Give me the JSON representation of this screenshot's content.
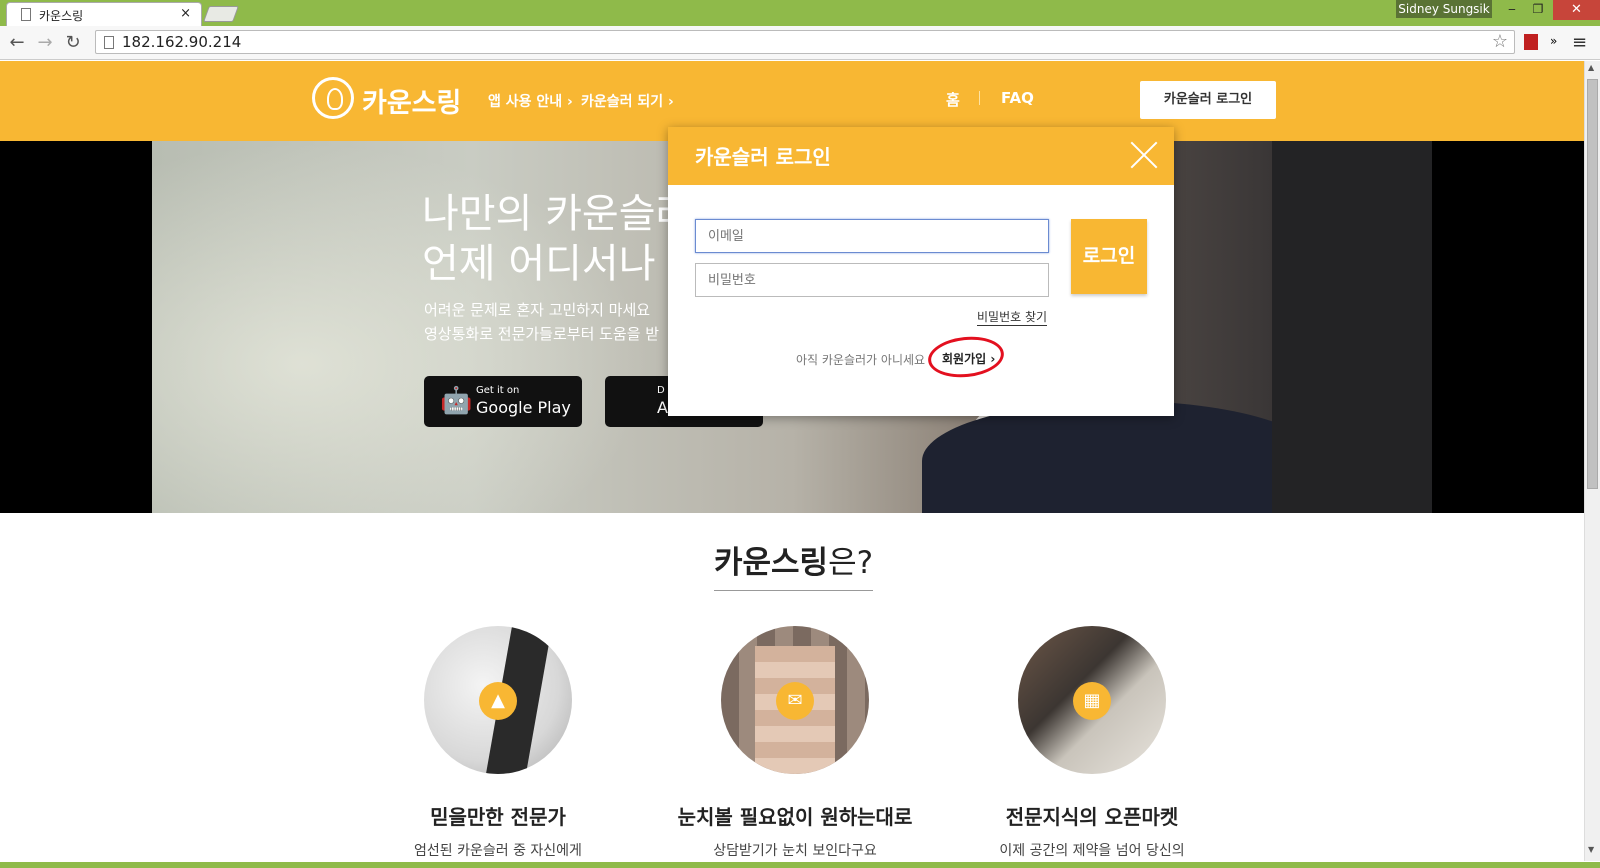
{
  "browser": {
    "tab_title": "카운스링",
    "tab_close": "×",
    "profile_name": "Sidney Sungsik",
    "url": "182.162.90.214",
    "minimize": "‒",
    "restore": "❐",
    "close": "✕",
    "back": "←",
    "forward": "→",
    "reload": "↻",
    "star": "☆",
    "more_extensions": "»",
    "menu": "≡"
  },
  "header": {
    "logo_text": "카운스링",
    "nav": [
      {
        "label": "앱 사용 안내 ›"
      },
      {
        "label": "카운슬러 되기 ›"
      }
    ],
    "home": "홈",
    "faq": "FAQ",
    "counselor_login": "카운슬러 로그인"
  },
  "hero": {
    "title_line1": "나만의 카운슬러",
    "title_line2": "언제 어디서나",
    "sub_line1": "어려운 문제로 혼자 고민하지 마세요",
    "sub_line2": "영상통화로 전문가들로부터 도움을 받",
    "google_small": "Get it on",
    "google_big": "Google Play",
    "apple_small": "D",
    "apple_big": "A"
  },
  "modal": {
    "title": "카운슬러 로그인",
    "email_placeholder": "이메일",
    "password_placeholder": "비밀번호",
    "login_button": "로그인",
    "find_password": "비밀번호 찾기",
    "not_yet": "아직 카운슬러가 아니세요",
    "signup": "회원가입 ›"
  },
  "intro": {
    "title_bold": "카운스링",
    "title_rest": "은?",
    "features": [
      {
        "title": "믿을만한 전문가",
        "desc": "엄선된 카운슬러 중 자신에게",
        "icon": "graduation-cap-icon"
      },
      {
        "title": "눈치볼 필요없이 원하는대로",
        "desc": "상담받기가 눈치 보인다구요",
        "icon": "chat-icon"
      },
      {
        "title": "전문지식의 오픈마켓",
        "desc": "이제 공간의 제약을 넘어 당신의",
        "icon": "store-icon"
      }
    ]
  },
  "colors": {
    "brand": "#f8b733",
    "chrome_green": "#8fba4a",
    "annotation_red": "#e3101f"
  }
}
